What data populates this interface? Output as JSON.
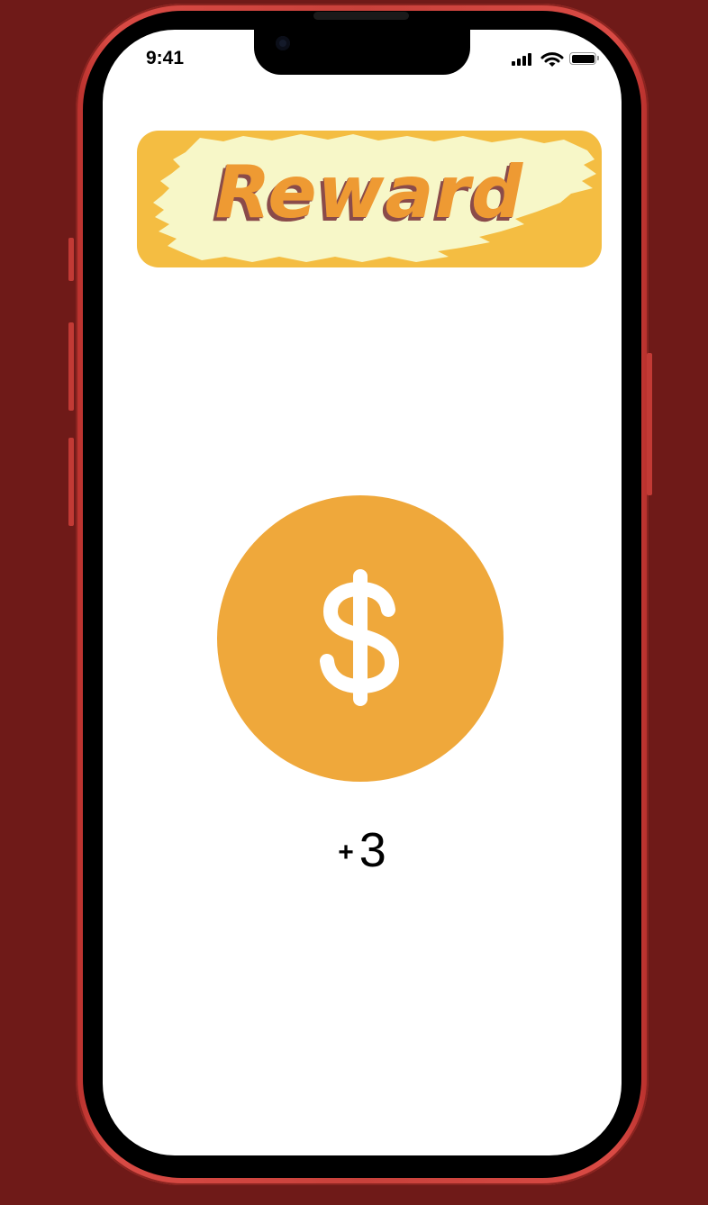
{
  "status_bar": {
    "time": "9:41",
    "icons": [
      "signal-icon",
      "wifi-icon",
      "battery-icon"
    ]
  },
  "banner": {
    "title": "Reward"
  },
  "coin": {
    "icon": "dollar-icon",
    "color": "#efa83b"
  },
  "reward": {
    "sign": "+",
    "amount": "3"
  },
  "colors": {
    "background": "#6f1a18",
    "phone_frame": "#c8413b",
    "banner": "#f4bd42",
    "banner_brush": "#f7f7c8",
    "title_text": "#ee9a33",
    "title_shadow": "#8a4b4a"
  }
}
